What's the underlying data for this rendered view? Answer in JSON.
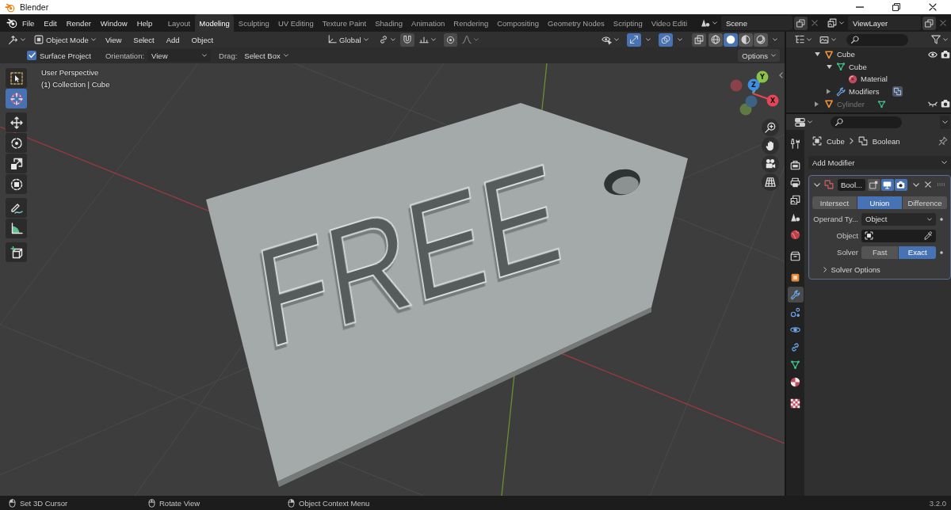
{
  "window": {
    "title": "Blender"
  },
  "menu": [
    "File",
    "Edit",
    "Render",
    "Window",
    "Help"
  ],
  "workspaces": [
    {
      "label": "Layout",
      "selected": false
    },
    {
      "label": "Modeling",
      "selected": true
    },
    {
      "label": "Sculpting",
      "selected": false
    },
    {
      "label": "UV Editing",
      "selected": false
    },
    {
      "label": "Texture Paint",
      "selected": false
    },
    {
      "label": "Shading",
      "selected": false
    },
    {
      "label": "Animation",
      "selected": false
    },
    {
      "label": "Rendering",
      "selected": false
    },
    {
      "label": "Compositing",
      "selected": false
    },
    {
      "label": "Geometry Nodes",
      "selected": false
    },
    {
      "label": "Scripting",
      "selected": false
    },
    {
      "label": "Video Editi",
      "selected": false
    }
  ],
  "scene": {
    "value": "Scene"
  },
  "view_layer": {
    "value": "ViewLayer"
  },
  "viewport_header": {
    "mode": "Object Mode",
    "menus": [
      "View",
      "Select",
      "Add",
      "Object"
    ],
    "orientation": "Global",
    "snap": {
      "on": false
    },
    "proportional": {
      "on": false
    },
    "gizmos": {
      "on": true
    },
    "overlays": {
      "on": true
    },
    "xray": {
      "on": false
    },
    "shading": [
      {
        "kind": "wireframe",
        "selected": false
      },
      {
        "kind": "solid",
        "selected": true
      },
      {
        "kind": "material",
        "selected": false
      },
      {
        "kind": "rendered",
        "selected": false
      }
    ]
  },
  "tool_settings": {
    "surface_project": {
      "label": "Surface Project",
      "checked": true
    },
    "orientation_label": "Orientation:",
    "orientation": "View",
    "drag_label": "Drag:",
    "drag": "Select Box",
    "options": "Options"
  },
  "tool_groups": [
    [
      {
        "kind": "select_box",
        "selected": false
      },
      {
        "kind": "cursor",
        "selected": true
      }
    ],
    [
      {
        "kind": "move",
        "selected": false
      },
      {
        "kind": "rotate",
        "selected": false
      },
      {
        "kind": "scale",
        "selected": false
      },
      {
        "kind": "transform",
        "selected": false
      }
    ],
    [
      {
        "kind": "annotate",
        "selected": false
      },
      {
        "kind": "measure",
        "selected": false
      }
    ],
    [
      {
        "kind": "add_cube",
        "selected": false
      }
    ]
  ],
  "viewport_info": [
    "User Perspective",
    "(1) Collection | Cube"
  ],
  "model": {
    "text": "FREE"
  },
  "axes": [
    {
      "label": "Y",
      "color": "#8bc34a"
    },
    {
      "label": "Z",
      "color": "#3d8fe0"
    },
    {
      "label": "X",
      "color": "#e5455a"
    }
  ],
  "outliner": {
    "items": [
      {
        "label": "Cube",
        "kind": "object",
        "expanded": true,
        "hidden": false,
        "children": [
          {
            "label": "Cube",
            "kind": "mesh",
            "expanded": true,
            "children": [
              {
                "label": "Material",
                "kind": "material"
              }
            ]
          },
          {
            "label": "Modifiers",
            "kind": "modifiers",
            "expanded": false
          }
        ]
      },
      {
        "label": "Cylinder",
        "kind": "object",
        "expanded": false,
        "hidden": true
      }
    ]
  },
  "properties": {
    "tab_groups": [
      [
        {
          "kind": "tool",
          "selected": false
        }
      ],
      [
        {
          "kind": "render",
          "selected": false
        },
        {
          "kind": "output",
          "selected": false
        },
        {
          "kind": "view_layer",
          "selected": false
        },
        {
          "kind": "scene",
          "selected": false
        },
        {
          "kind": "world",
          "selected": false
        }
      ],
      [
        {
          "kind": "collection",
          "selected": false
        }
      ],
      [
        {
          "kind": "object",
          "selected": false
        },
        {
          "kind": "modifiers",
          "selected": true
        },
        {
          "kind": "particles",
          "selected": false
        },
        {
          "kind": "physics",
          "selected": false
        },
        {
          "kind": "constraints",
          "selected": false
        },
        {
          "kind": "data",
          "selected": false
        },
        {
          "kind": "material",
          "selected": false
        }
      ],
      [
        {
          "kind": "texture",
          "selected": false
        }
      ]
    ],
    "breadcrumb": [
      "Cube",
      "Boolean"
    ],
    "add_modifier": "Add Modifier",
    "modifier": {
      "name": "Bool...",
      "expanded": true,
      "edit_mode": false,
      "show_viewport": true,
      "show_render": true,
      "operations": [
        {
          "label": "Intersect",
          "selected": false
        },
        {
          "label": "Union",
          "selected": true
        },
        {
          "label": "Difference",
          "selected": false
        }
      ],
      "operand_label": "Operand Ty...",
      "operand": "Object",
      "object_label": "Object",
      "solver_label": "Solver",
      "solvers": [
        {
          "label": "Fast",
          "selected": false
        },
        {
          "label": "Exact",
          "selected": true
        }
      ],
      "solver_options": {
        "label": "Solver Options",
        "expanded": false
      }
    }
  },
  "status": {
    "hints": [
      {
        "kind": "left",
        "label": "Set 3D Cursor"
      },
      {
        "kind": "middle",
        "label": "Rotate View"
      },
      {
        "kind": "right",
        "label": "Object Context Menu"
      }
    ],
    "version": "3.2.0"
  }
}
